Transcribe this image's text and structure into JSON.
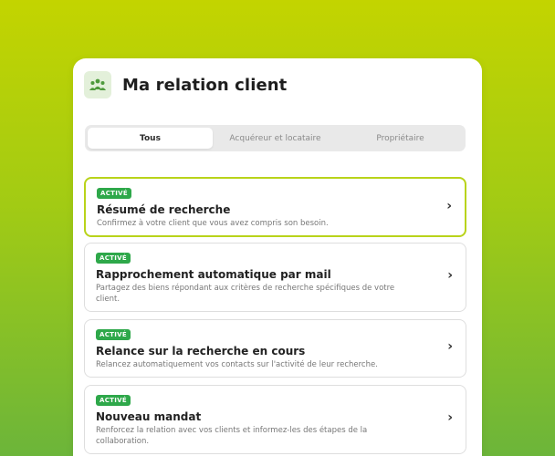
{
  "header": {
    "title": "Ma relation client",
    "icon": "people-group-icon"
  },
  "tabs": [
    {
      "label": "Tous",
      "active": true
    },
    {
      "label": "Acquéreur et locataire",
      "active": false
    },
    {
      "label": "Propriétaire",
      "active": false
    }
  ],
  "cards": [
    {
      "badge": "ACTIVÉ",
      "title": "Résumé de recherche",
      "description": "Confirmez à votre client que vous avez compris son besoin.",
      "selected": true
    },
    {
      "badge": "ACTIVÉ",
      "title": "Rapprochement automatique par mail",
      "description": "Partagez des biens répondant aux critères de recherche spécifiques de votre client.",
      "selected": false
    },
    {
      "badge": "ACTIVÉ",
      "title": "Relance sur la recherche en cours",
      "description": "Relancez automatiquement vos contacts sur l'activité de leur recherche.",
      "selected": false
    },
    {
      "badge": "ACTIVÉ",
      "title": "Nouveau mandat",
      "description": "Renforcez la relation avec vos clients et informez-les des étapes de la collaboration.",
      "selected": false
    }
  ],
  "colors": {
    "accent": "#b9d31a",
    "badge": "#2ea84a",
    "background_top": "#c3d400",
    "background_bottom": "#6cb53a"
  }
}
